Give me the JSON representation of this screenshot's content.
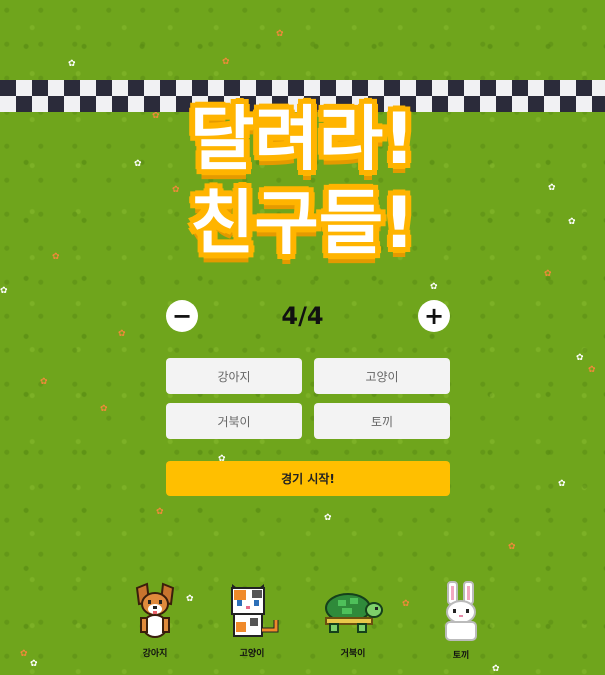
{
  "title": {
    "line1": "달려라!",
    "line2": "친구들!"
  },
  "count": {
    "minus_label": "−",
    "plus_label": "+",
    "value": "4/4"
  },
  "names": [
    {
      "placeholder": "강아지"
    },
    {
      "placeholder": "고양이"
    },
    {
      "placeholder": "거북이"
    },
    {
      "placeholder": "토끼"
    }
  ],
  "start_button": {
    "label": "경기 시작!"
  },
  "racers": [
    {
      "label": "강아지",
      "icon": "dog-icon"
    },
    {
      "label": "고양이",
      "icon": "cat-icon"
    },
    {
      "label": "거북이",
      "icon": "turtle-icon"
    },
    {
      "label": "토끼",
      "icon": "rabbit-icon"
    }
  ],
  "colors": {
    "grass": "#6fa51c",
    "title_outline": "#ffb400",
    "start_button": "#ffbf00",
    "checker_dark": "#2b2b3a"
  }
}
